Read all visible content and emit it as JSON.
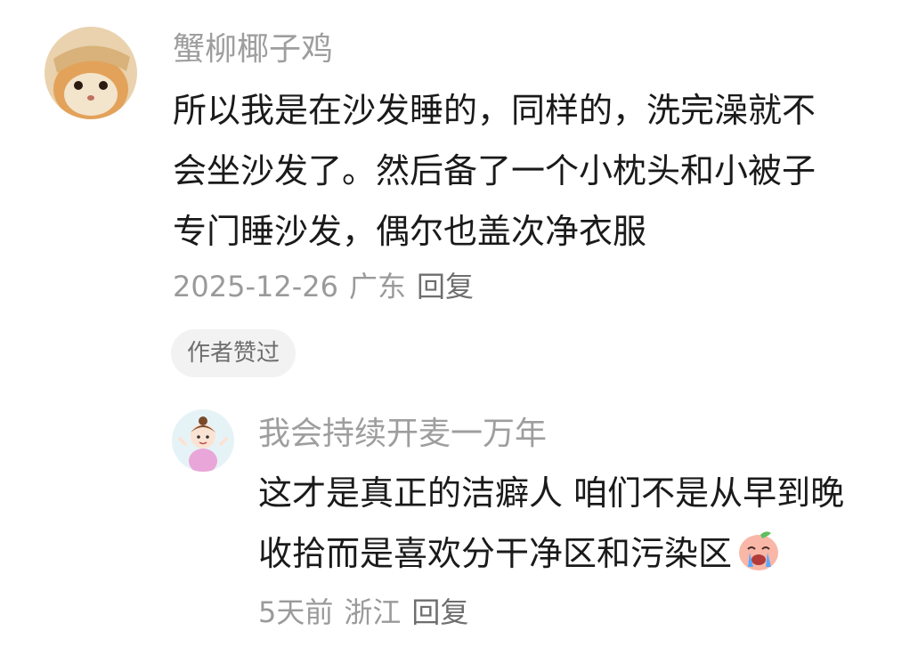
{
  "comment": {
    "avatar_icon": "cat-avatar-icon",
    "username": "蟹柳椰子鸡",
    "lines": [
      "所以我是在沙发睡的，同样的，洗完澡就不",
      "会坐沙发了。然后备了一个小枕头和小被子",
      "专门睡沙发，偶尔也盖次净衣服"
    ],
    "date": "2025-12-26",
    "location": "广东",
    "reply_label": "回复",
    "author_liked_badge": "作者赞过"
  },
  "reply": {
    "avatar_icon": "girl-cartoon-avatar-icon",
    "username": "我会持续开麦一万年",
    "lines": [
      "这才是真正的洁癖人 咱们不是从早到晚",
      "收拾而是喜欢分干净区和污染区"
    ],
    "emoji_icon": "crying-face-emoji-icon",
    "date": "5天前",
    "location": "浙江",
    "reply_label": "回复"
  }
}
